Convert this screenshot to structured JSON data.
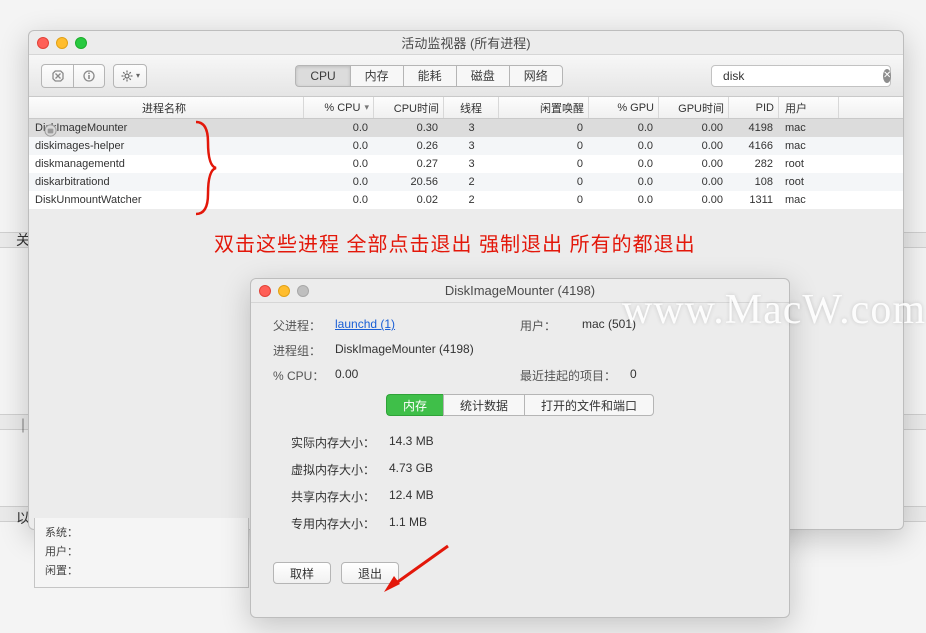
{
  "main": {
    "title": "活动监视器 (所有进程)",
    "tabs": [
      "CPU",
      "内存",
      "能耗",
      "磁盘",
      "网络"
    ],
    "active_tab": 0,
    "search_value": "disk",
    "columns": {
      "name": "进程名称",
      "cpu": "% CPU",
      "cputime": "CPU时间",
      "threads": "线程",
      "wake": "闲置唤醒",
      "gpu": "% GPU",
      "gputime": "GPU时间",
      "pid": "PID",
      "user": "用户"
    },
    "rows": [
      {
        "name": "DiskImageMounter",
        "cpu": "0.0",
        "cputime": "0.30",
        "threads": "3",
        "wake": "0",
        "gpu": "0.0",
        "gputime": "0.00",
        "pid": "4198",
        "user": "mac",
        "icon": true,
        "sel": true
      },
      {
        "name": "diskimages-helper",
        "cpu": "0.0",
        "cputime": "0.26",
        "threads": "3",
        "wake": "0",
        "gpu": "0.0",
        "gputime": "0.00",
        "pid": "4166",
        "user": "mac"
      },
      {
        "name": "diskmanagementd",
        "cpu": "0.0",
        "cputime": "0.27",
        "threads": "3",
        "wake": "0",
        "gpu": "0.0",
        "gputime": "0.00",
        "pid": "282",
        "user": "root"
      },
      {
        "name": "diskarbitrationd",
        "cpu": "0.0",
        "cputime": "20.56",
        "threads": "2",
        "wake": "0",
        "gpu": "0.0",
        "gputime": "0.00",
        "pid": "108",
        "user": "root"
      },
      {
        "name": "DiskUnmountWatcher",
        "cpu": "0.0",
        "cputime": "0.02",
        "threads": "2",
        "wake": "0",
        "gpu": "0.0",
        "gputime": "0.00",
        "pid": "1311",
        "user": "mac"
      }
    ],
    "footer": {
      "sys": "系统：",
      "user": "用户：",
      "idle": "闲置："
    }
  },
  "annotation": "双击这些进程 全部点击退出 强制退出  所有的都退出",
  "detail": {
    "title": "DiskImageMounter (4198)",
    "parent_label": "父进程：",
    "parent_val": "launchd (1)",
    "user_label": "用户：",
    "user_val": "mac (501)",
    "group_label": "进程组：",
    "group_val": "DiskImageMounter (4198)",
    "cpu_label": "% CPU：",
    "cpu_val": "0.00",
    "hang_label": "最近挂起的项目：",
    "hang_val": "0",
    "tabs": [
      "内存",
      "统计数据",
      "打开的文件和端口"
    ],
    "mem": [
      {
        "l": "实际内存大小：",
        "v": "14.3 MB"
      },
      {
        "l": "虚拟内存大小：",
        "v": "4.73 GB"
      },
      {
        "l": "共享内存大小：",
        "v": "12.4 MB"
      },
      {
        "l": "专用内存大小：",
        "v": "1.1 MB"
      }
    ],
    "btn_sample": "取样",
    "btn_quit": "退出"
  },
  "watermark": "www.MacW.com"
}
